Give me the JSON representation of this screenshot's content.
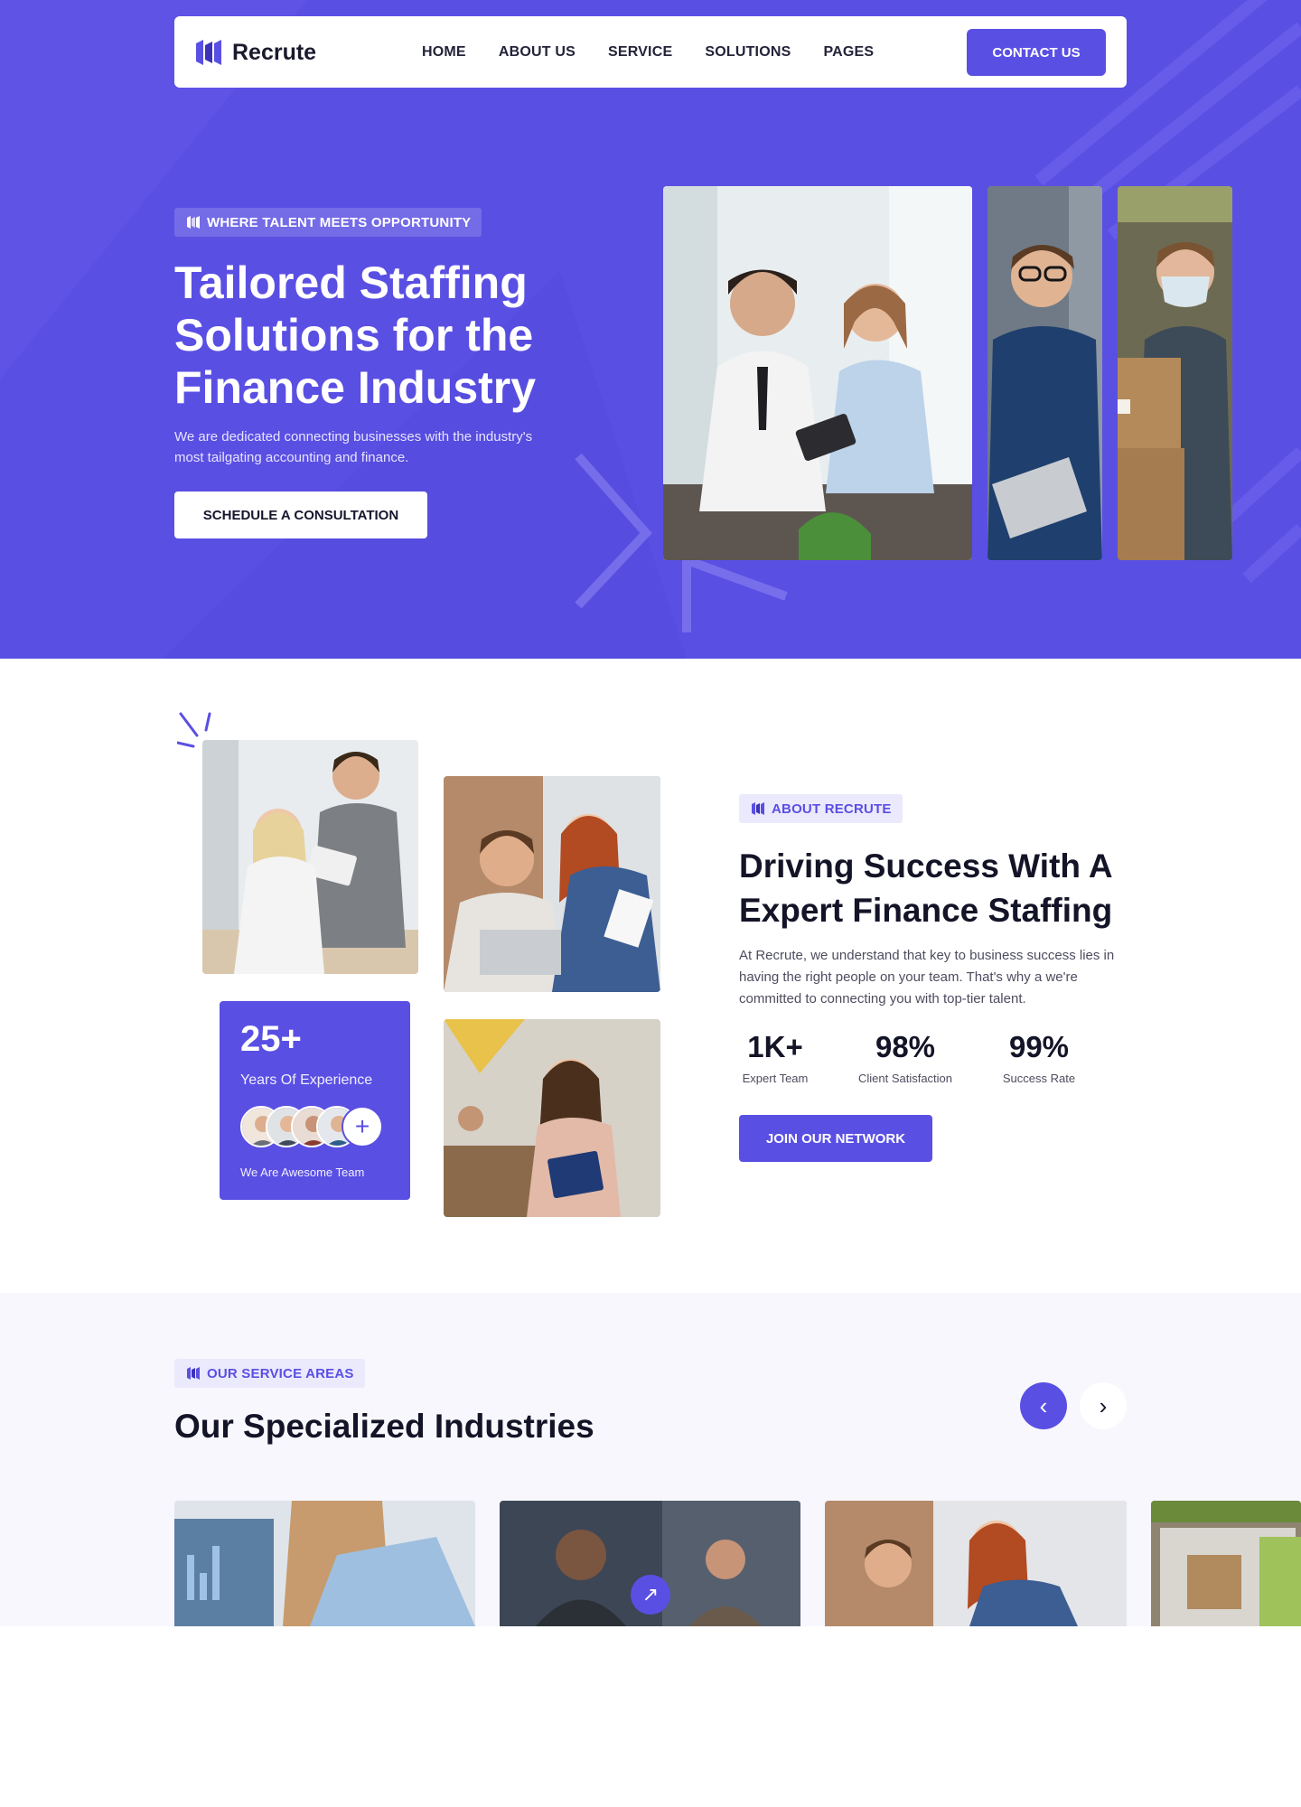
{
  "brand": {
    "name": "Recrute",
    "accent": "#5a4fe3"
  },
  "nav": {
    "links": [
      "HOME",
      "ABOUT US",
      "SERVICE",
      "SOLUTIONS",
      "PAGES"
    ],
    "contact_label": "CONTACT US"
  },
  "hero": {
    "tag": "WHERE TALENT MEETS OPPORTUNITY",
    "title": "Tailored Staffing Solutions for the Finance Industry",
    "description": "We are dedicated connecting businesses with the industry's most tailgating accounting and finance.",
    "cta_label": "SCHEDULE A CONSULTATION"
  },
  "about": {
    "tag": "ABOUT RECRUTE",
    "title": "Driving Success With A Expert Finance Staffing",
    "description": "At Recrute, we understand that key to business success lies in having the right people on your team. That's why a we're committed to connecting you with top-tier talent.",
    "stats": [
      {
        "value": "1K+",
        "label": "Expert Team"
      },
      {
        "value": "98%",
        "label": "Client Satisfaction"
      },
      {
        "value": "99%",
        "label": "Success Rate"
      }
    ],
    "cta_label": "JOIN OUR NETWORK",
    "experience": {
      "value": "25+",
      "label": "Years Of Experience",
      "team_label": "We Are Awesome Team",
      "plus_icon": "+"
    }
  },
  "services": {
    "tag": "OUR SERVICE AREAS",
    "title": "Our Specialized Industries",
    "prev_icon": "‹",
    "next_icon": "›",
    "card_link_icon": "↗"
  }
}
